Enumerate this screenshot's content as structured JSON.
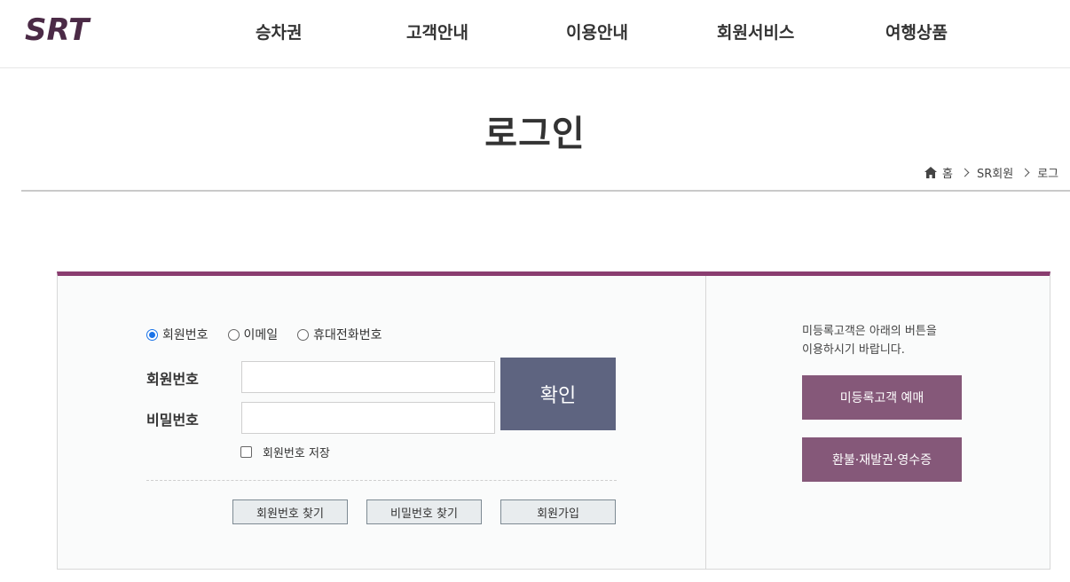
{
  "header": {
    "logo_text": "SRT",
    "nav": [
      "승차권",
      "고객안내",
      "이용안내",
      "회원서비스",
      "여행상품"
    ]
  },
  "page": {
    "title": "로그인",
    "breadcrumb": [
      "홈",
      "SR회원",
      "로그"
    ]
  },
  "login": {
    "login_types": [
      {
        "label": "회원번호",
        "checked": true
      },
      {
        "label": "이메일",
        "checked": false
      },
      {
        "label": "휴대전화번호",
        "checked": false
      }
    ],
    "member_no_label": "회원번호",
    "member_no_value": "",
    "password_label": "비밀번호",
    "password_value": "",
    "confirm_label": "확인",
    "save_label": "회원번호 저장",
    "find_member_no": "회원번호 찾기",
    "find_password": "비밀번호 찾기",
    "signup": "회원가입"
  },
  "guest": {
    "guide_line1": "미등록고객은 아래의 버튼을",
    "guide_line2": "이용하시기 바랍니다.",
    "reserve_label": "미등록고객 예매",
    "refund_label": "환불·재발권·영수증"
  },
  "colors": {
    "brand": "#8a3d70",
    "confirm": "#5e6480",
    "guest_button": "#855879"
  }
}
